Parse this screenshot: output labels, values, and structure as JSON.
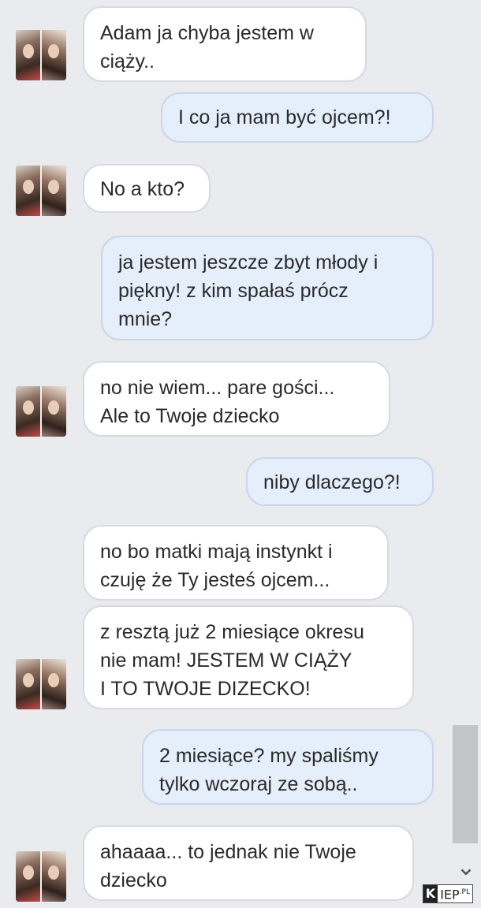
{
  "messages": [
    {
      "side": "in",
      "text": "Adam ja chyba jestem w\nciąży.."
    },
    {
      "side": "out",
      "text": "I co ja mam być ojcem?!"
    },
    {
      "side": "in",
      "text": "No a kto?"
    },
    {
      "side": "out",
      "text": "ja jestem jeszcze zbyt młody i\npiękny! z kim spałaś prócz\nmnie?"
    },
    {
      "side": "in",
      "text": "no nie wiem... pare gości...\nAle to Twoje dziecko"
    },
    {
      "side": "out",
      "text": "niby dlaczego?!"
    },
    {
      "side": "in",
      "text": "no bo matki mają instynkt i\nczuję że Ty jesteś ojcem..."
    },
    {
      "side": "in",
      "text": "z resztą już 2 miesiące okresu\nnie mam! JESTEM W CIĄŻY\nI TO TWOJE DIZECKO!"
    },
    {
      "side": "out",
      "text": "2 miesiące? my spaliśmy\ntylko wczoraj ze sobą.."
    },
    {
      "side": "in",
      "text": "ahaaaa... to jednak nie Twoje\ndziecko"
    }
  ],
  "watermark": {
    "brand_k": "K",
    "brand_rest": "IEP",
    "brand_suffix": ".PL"
  },
  "icons": {
    "scroll_down": "chevron-down-icon",
    "avatar": "contact-avatar"
  },
  "colors": {
    "background": "#e9ebee",
    "incoming": "#ffffff",
    "outgoing": "#e5eefb"
  }
}
